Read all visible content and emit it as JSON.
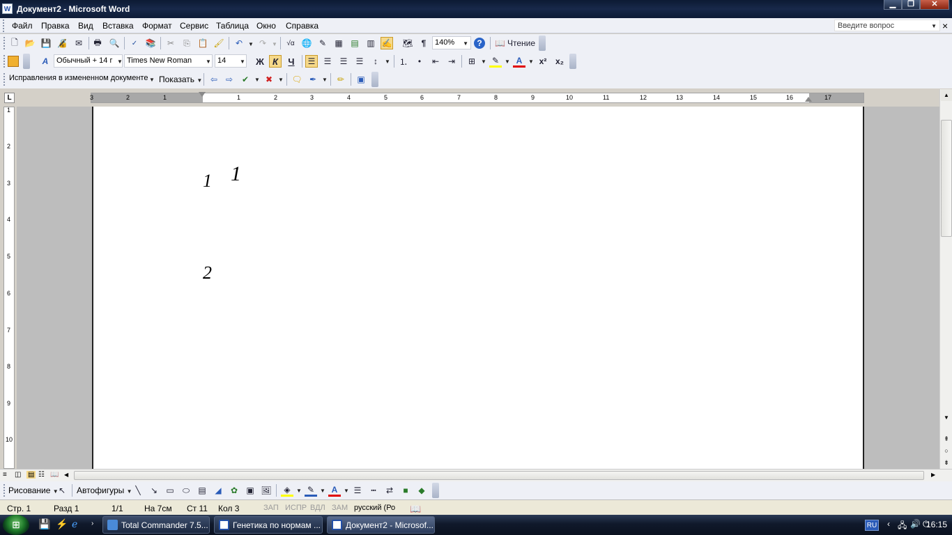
{
  "window": {
    "title": "Документ2 - Microsoft Word",
    "app_icon": "W",
    "min": "▁",
    "max": "❐",
    "close": "✕"
  },
  "menubar": {
    "items": [
      "Файл",
      "Правка",
      "Вид",
      "Вставка",
      "Формат",
      "Сервис",
      "Таблица",
      "Окно",
      "Справка"
    ],
    "ask_placeholder": "Введите вопрос",
    "close_doc": "×"
  },
  "standard_toolbar": {
    "zoom": "140%",
    "reading_label": "Чтение"
  },
  "formatting_toolbar": {
    "style": "Обычный + 14 г",
    "font": "Times New Roman",
    "size": "14",
    "bold": "Ж",
    "italic": "К",
    "underline": "Ч",
    "superscript": "x²",
    "subscript": "x₂"
  },
  "reviewing_toolbar": {
    "mode": "Исправления в измененном документе",
    "show_label": "Показать"
  },
  "ruler": {
    "tab_selector": "L",
    "h_ticks": [
      "3",
      "2",
      "1",
      "1",
      "2",
      "3",
      "4",
      "5",
      "6",
      "7",
      "8",
      "9",
      "10",
      "11",
      "12",
      "13",
      "14",
      "15",
      "16",
      "17"
    ],
    "v_ticks": [
      "1",
      "2",
      "3",
      "4",
      "5",
      "6",
      "7",
      "8",
      "9",
      "10"
    ]
  },
  "document": {
    "text1": "1",
    "text2": "1",
    "text3": "2"
  },
  "drawing_toolbar": {
    "draw_label": "Рисование",
    "autoshapes_label": "Автофигуры"
  },
  "statusbar": {
    "page": "Стр. 1",
    "section": "Разд 1",
    "pages": "1/1",
    "at": "На 7см",
    "line": "Ст 11",
    "col": "Кол 3",
    "rec": "ЗАП",
    "trk": "ИСПР",
    "ext": "ВДЛ",
    "ovr": "ЗАМ",
    "lang": "русский (Ро"
  },
  "taskbar": {
    "tasks": [
      "Total Commander 7.5...",
      "Генетика по нормам ...",
      "Документ2 - Microsof..."
    ],
    "lang": "RU",
    "clock": "16:15"
  },
  "colors": {
    "title_bg": "#0c1a33",
    "toolbar_bg": "#eef0f6",
    "workspace": "#bdbdbd",
    "font_color_red": "#e00000",
    "highlight_yellow": "#ffff00"
  }
}
